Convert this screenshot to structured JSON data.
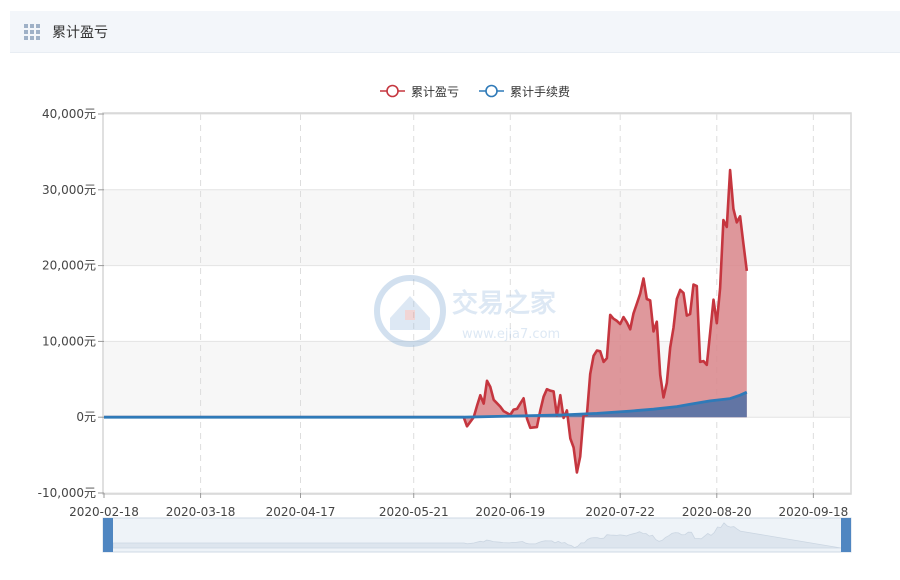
{
  "panel": {
    "title": "累计盈亏",
    "icon": "grid-icon"
  },
  "watermark": {
    "name": "交易之家",
    "url": "www.ejia7.com"
  },
  "colors": {
    "profit": "#c5363f",
    "profit_fill": "#d9868b",
    "fee": "#2f7ab8",
    "fee_fill": "#5b73a4",
    "grid": "#e3e3e3",
    "band": "#f7f7f7"
  },
  "chart_data": {
    "type": "area",
    "title": "",
    "x_ticks": [
      "2020-02-18",
      "2020-03-18",
      "2020-04-17",
      "2020-05-21",
      "2020-06-19",
      "2020-07-22",
      "2020-08-20",
      "2020-09-18"
    ],
    "y_ticks": [
      "-10,000元",
      "0元",
      "10,000元",
      "20,000元",
      "30,000元",
      "40,000元"
    ],
    "ylim": [
      -10000,
      40000
    ],
    "y_unit": "元",
    "legend": {
      "position": "top-center"
    },
    "x_range": [
      "2020-02-18",
      "2020-09-29"
    ],
    "series": [
      {
        "name": "累计盈亏",
        "color": "#c5363f",
        "points": [
          [
            "2020-02-18",
            0
          ],
          [
            "2020-06-05",
            0
          ],
          [
            "2020-06-06",
            -1200
          ],
          [
            "2020-06-08",
            0
          ],
          [
            "2020-06-09",
            1500
          ],
          [
            "2020-06-10",
            2900
          ],
          [
            "2020-06-11",
            1800
          ],
          [
            "2020-06-12",
            4800
          ],
          [
            "2020-06-13",
            4000
          ],
          [
            "2020-06-14",
            2300
          ],
          [
            "2020-06-16",
            1400
          ],
          [
            "2020-06-17",
            800
          ],
          [
            "2020-06-19",
            300
          ],
          [
            "2020-06-20",
            1000
          ],
          [
            "2020-06-21",
            1100
          ],
          [
            "2020-06-22",
            1800
          ],
          [
            "2020-06-23",
            2500
          ],
          [
            "2020-06-24",
            -200
          ],
          [
            "2020-06-25",
            -1400
          ],
          [
            "2020-06-27",
            -1300
          ],
          [
            "2020-06-28",
            900
          ],
          [
            "2020-06-29",
            2700
          ],
          [
            "2020-06-30",
            3700
          ],
          [
            "2020-07-01",
            3500
          ],
          [
            "2020-07-02",
            3400
          ],
          [
            "2020-07-03",
            200
          ],
          [
            "2020-07-04",
            2900
          ],
          [
            "2020-07-05",
            -100
          ],
          [
            "2020-07-06",
            900
          ],
          [
            "2020-07-07",
            -2800
          ],
          [
            "2020-07-08",
            -4000
          ],
          [
            "2020-07-09",
            -7300
          ],
          [
            "2020-07-10",
            -5200
          ],
          [
            "2020-07-11",
            300
          ],
          [
            "2020-07-12",
            300
          ],
          [
            "2020-07-13",
            5700
          ],
          [
            "2020-07-14",
            8100
          ],
          [
            "2020-07-15",
            8800
          ],
          [
            "2020-07-16",
            8700
          ],
          [
            "2020-07-17",
            7300
          ],
          [
            "2020-07-18",
            7800
          ],
          [
            "2020-07-19",
            13500
          ],
          [
            "2020-07-20",
            13000
          ],
          [
            "2020-07-21",
            12700
          ],
          [
            "2020-07-22",
            12300
          ],
          [
            "2020-07-23",
            13200
          ],
          [
            "2020-07-24",
            12500
          ],
          [
            "2020-07-25",
            11600
          ],
          [
            "2020-07-26",
            13700
          ],
          [
            "2020-07-27",
            15000
          ],
          [
            "2020-07-28",
            16300
          ],
          [
            "2020-07-29",
            18300
          ],
          [
            "2020-07-30",
            15600
          ],
          [
            "2020-07-31",
            15400
          ],
          [
            "2020-08-01",
            11300
          ],
          [
            "2020-08-02",
            12600
          ],
          [
            "2020-08-03",
            5600
          ],
          [
            "2020-08-04",
            2600
          ],
          [
            "2020-08-05",
            4500
          ],
          [
            "2020-08-06",
            9200
          ],
          [
            "2020-08-07",
            11800
          ],
          [
            "2020-08-08",
            15600
          ],
          [
            "2020-08-09",
            16800
          ],
          [
            "2020-08-10",
            16400
          ],
          [
            "2020-08-11",
            13400
          ],
          [
            "2020-08-12",
            13600
          ],
          [
            "2020-08-13",
            17500
          ],
          [
            "2020-08-14",
            17300
          ],
          [
            "2020-08-15",
            7300
          ],
          [
            "2020-08-16",
            7400
          ],
          [
            "2020-08-17",
            6900
          ],
          [
            "2020-08-18",
            11100
          ],
          [
            "2020-08-19",
            15500
          ],
          [
            "2020-08-20",
            12400
          ],
          [
            "2020-08-21",
            17000
          ],
          [
            "2020-08-22",
            26000
          ],
          [
            "2020-08-23",
            25100
          ],
          [
            "2020-08-24",
            32600
          ],
          [
            "2020-08-25",
            27500
          ],
          [
            "2020-08-26",
            25700
          ],
          [
            "2020-08-27",
            26500
          ],
          [
            "2020-08-28",
            22900
          ],
          [
            "2020-08-29",
            19300
          ]
        ]
      },
      {
        "name": "累计手续费",
        "color": "#2f7ab8",
        "points": [
          [
            "2020-02-18",
            0
          ],
          [
            "2020-06-05",
            0
          ],
          [
            "2020-06-19",
            150
          ],
          [
            "2020-07-05",
            300
          ],
          [
            "2020-07-15",
            500
          ],
          [
            "2020-07-25",
            800
          ],
          [
            "2020-08-01",
            1050
          ],
          [
            "2020-08-08",
            1400
          ],
          [
            "2020-08-12",
            1700
          ],
          [
            "2020-08-18",
            2150
          ],
          [
            "2020-08-24",
            2450
          ],
          [
            "2020-08-27",
            2900
          ],
          [
            "2020-08-29",
            3300
          ]
        ]
      }
    ]
  }
}
